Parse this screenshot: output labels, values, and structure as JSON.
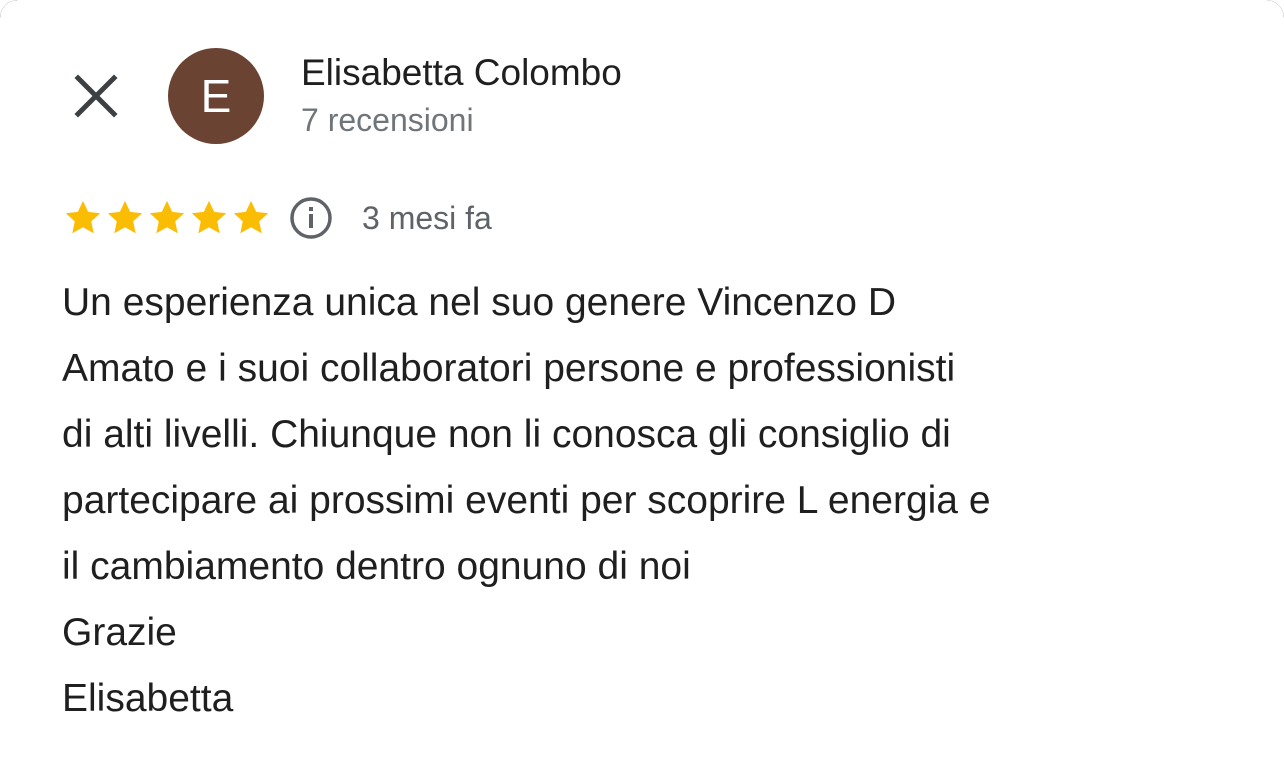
{
  "reviewer": {
    "avatar_initial": "E",
    "name": "Elisabetta Colombo",
    "reviews_count": "7 recensioni"
  },
  "review": {
    "rating": 5,
    "max_rating": 5,
    "date": "3 mesi fa",
    "text": "Un esperienza unica nel suo genere Vincenzo D\nAmato e i suoi collaboratori persone e professionisti\ndi alti livelli. Chiunque non li conosca gli consiglio di\npartecipare ai prossimi eventi per scoprire L energia e\nil cambiamento dentro ognuno di noi\nGrazie\nElisabetta"
  },
  "icons": {
    "close": "close-icon",
    "star": "star-icon",
    "info": "info-icon"
  },
  "colors": {
    "avatar_bg": "#6b4332",
    "star": "#fbbc04",
    "secondary_text": "#70757a",
    "primary_text": "#1f1f1f"
  }
}
